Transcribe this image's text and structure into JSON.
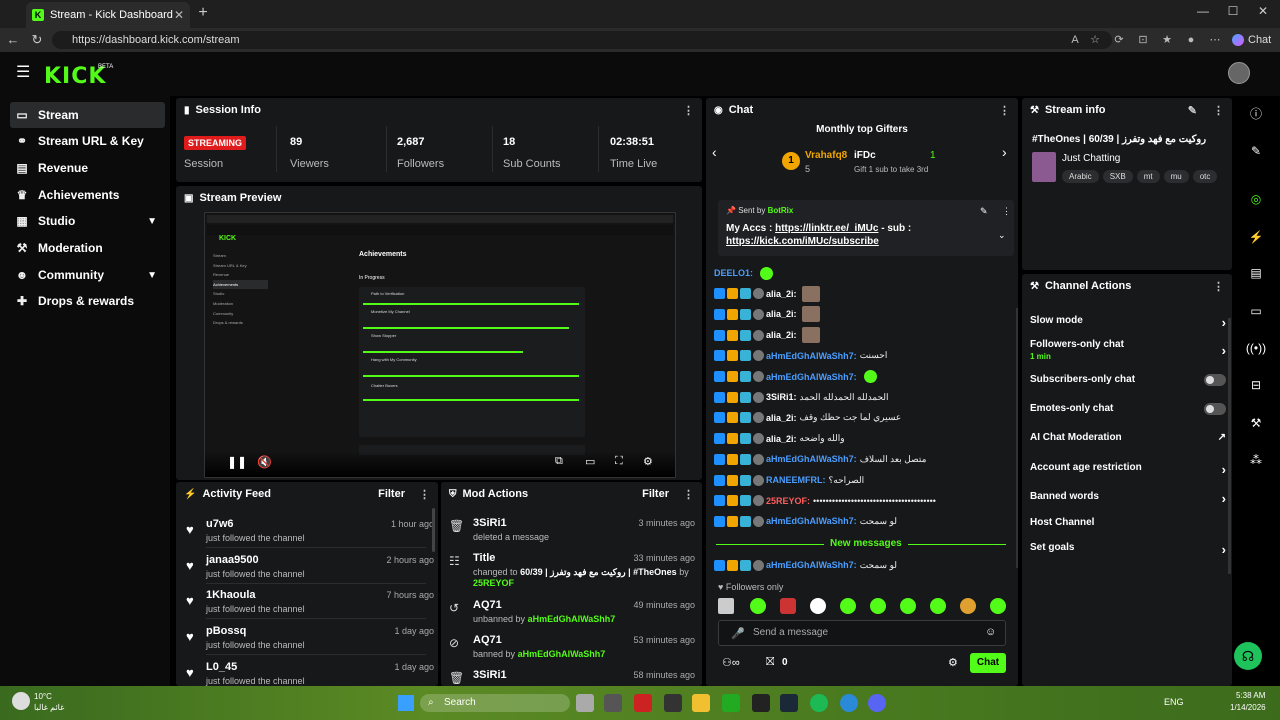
{
  "browser": {
    "tab_title": "Stream - Kick Dashboard",
    "url": "https://dashboard.kick.com/stream",
    "chat_button": "Chat"
  },
  "header": {
    "logo": "KICK",
    "beta": "BETA"
  },
  "sidebar": {
    "items": [
      {
        "label": "Stream",
        "icon": "stream-icon"
      },
      {
        "label": "Stream URL & Key",
        "icon": "link-icon"
      },
      {
        "label": "Revenue",
        "icon": "revenue-icon"
      },
      {
        "label": "Achievements",
        "icon": "trophy-icon"
      },
      {
        "label": "Studio",
        "icon": "studio-icon"
      },
      {
        "label": "Moderation",
        "icon": "wrench-icon"
      },
      {
        "label": "Community",
        "icon": "community-icon"
      },
      {
        "label": "Drops & rewards",
        "icon": "gift-icon"
      }
    ]
  },
  "session": {
    "title": "Session Info",
    "badge": "STREAMING",
    "session_label": "Session",
    "stats": [
      {
        "value": "89",
        "label": "Viewers"
      },
      {
        "value": "2,687",
        "label": "Followers"
      },
      {
        "value": "18",
        "label": "Sub Counts"
      },
      {
        "value": "02:38:51",
        "label": "Time Live"
      }
    ]
  },
  "preview": {
    "title": "Stream Preview",
    "inner_heading": "Achievements",
    "inner_section": "In Progress",
    "inner_items": [
      "Path to Verification",
      "Monetize My Channel",
      "Show Stopper",
      "Hang with My Community",
      "Chatter Boxers"
    ],
    "inner_sidebar": [
      "Stream",
      "Stream URL & Key",
      "Revenue",
      "Achievements",
      "Studio",
      "Moderation",
      "Community",
      "Drops & rewards"
    ]
  },
  "activity": {
    "title": "Activity Feed",
    "filter": "Filter",
    "rows": [
      {
        "name": "u7w6",
        "action": "just followed the channel",
        "time": "1 hour ago"
      },
      {
        "name": "janaa9500",
        "action": "just followed the channel",
        "time": "2 hours ago"
      },
      {
        "name": "1Khaoula",
        "action": "just followed the channel",
        "time": "7 hours ago"
      },
      {
        "name": "pBossq",
        "action": "just followed the channel",
        "time": "1 day ago"
      },
      {
        "name": "L0_45",
        "action": "just followed the channel",
        "time": "1 day ago"
      }
    ]
  },
  "mod": {
    "title": "Mod Actions",
    "filter": "Filter",
    "rows": [
      {
        "name": "3SiRi1",
        "line1": "deleted a message",
        "time": "3 minutes ago"
      },
      {
        "name": "Title",
        "line1": "changed to",
        "line1b": "روكيت مع فهد وتفرز | 60/39 | #TheOnes",
        "line2": "by",
        "line2b": "25REYOF",
        "time": "33 minutes ago"
      },
      {
        "name": "AQ71",
        "line1": "unbanned by",
        "line1b": "aHmEdGhAlWaShh7",
        "time": "49 minutes ago"
      },
      {
        "name": "AQ71",
        "line1": "banned by",
        "line1b": "aHmEdGhAlWaShh7",
        "time": "53 minutes ago"
      },
      {
        "name": "3SiRi1",
        "line1": "",
        "time": "58 minutes ago"
      }
    ]
  },
  "chat": {
    "title": "Chat",
    "gifters_title": "Monthly top Gifters",
    "gifter1": {
      "rank": "1",
      "name": "Vrahafq8",
      "count": "5"
    },
    "gifter2": {
      "name": "iFDc",
      "count": "1",
      "note": "Gift 1 sub to take 3rd"
    },
    "pinned": {
      "sent_by": "Sent by",
      "sender": "BotRix",
      "text": "My Accs : ",
      "link1": "https://linktr.ee/_iMUc",
      "mid": " - sub :",
      "link2": "https://kick.com/iMUc/subscribe"
    },
    "messages": [
      {
        "user": "DEELO1:",
        "color": "blue",
        "text": ""
      },
      {
        "user": "alia_2i:",
        "color": "white",
        "text": ""
      },
      {
        "user": "alia_2i:",
        "color": "white",
        "text": ""
      },
      {
        "user": "alia_2i:",
        "color": "white",
        "text": ""
      },
      {
        "user": "aHmEdGhAlWaShh7:",
        "color": "blue",
        "text": "احسنت"
      },
      {
        "user": "aHmEdGhAlWaShh7:",
        "color": "blue",
        "text": ""
      },
      {
        "user": "3SiRi1:",
        "color": "white",
        "text": "الحمدلله الحمدلله الحمد"
      },
      {
        "user": "alia_2i:",
        "color": "white",
        "text": "عسيري لما جت حظك وقف"
      },
      {
        "user": "alia_2i:",
        "color": "white",
        "text": "والله واضحه"
      },
      {
        "user": "aHmEdGhAlWaShh7:",
        "color": "blue",
        "text": "متصل بعد السلاف"
      },
      {
        "user": "RANEEMFRL:",
        "color": "blue",
        "text": "الصراحه؟"
      },
      {
        "user": "25REYOF:",
        "color": "red",
        "text": "•••••••••••••••••••••••••••••••••••••••"
      },
      {
        "user": "aHmEdGhAlWaShh7:",
        "color": "blue",
        "text": "لو سمحت"
      }
    ],
    "new_messages": "New messages",
    "last_message": {
      "user": "aHmEdGhAlWaShh7:",
      "text": "لو سمحت"
    },
    "followers_only": "Followers only",
    "placeholder": "Send a message",
    "points": "0",
    "send": "Chat"
  },
  "stream_info": {
    "title": "Stream info",
    "stream_title": "#TheOnes | 60/39 | روكيت مع فهد وتفرز",
    "category": "Just Chatting",
    "tags": [
      "Arabic",
      "SXB",
      "mt",
      "mu",
      "otc"
    ]
  },
  "channel_actions": {
    "title": "Channel Actions",
    "items": [
      {
        "label": "Slow mode",
        "type": "arrow"
      },
      {
        "label": "Followers-only chat",
        "sub": "1 min",
        "type": "arrow"
      },
      {
        "label": "Subscribers-only chat",
        "type": "toggle"
      },
      {
        "label": "Emotes-only chat",
        "type": "toggle"
      },
      {
        "label": "AI Chat Moderation",
        "type": "external"
      },
      {
        "label": "Account age restriction",
        "type": "arrow"
      },
      {
        "label": "Banned words",
        "type": "arrow"
      },
      {
        "label": "Host Channel",
        "type": "none"
      },
      {
        "label": "Set goals",
        "type": "arrow"
      }
    ]
  },
  "taskbar": {
    "weather_temp": "10°C",
    "weather_text": "غائم غالبا",
    "search": "Search",
    "lang": "ENG",
    "time": "5:38 AM",
    "date": "1/14/2026"
  },
  "colors": {
    "accent": "#53fc18",
    "streaming": "#e01b1b",
    "panel": "#17181a"
  }
}
